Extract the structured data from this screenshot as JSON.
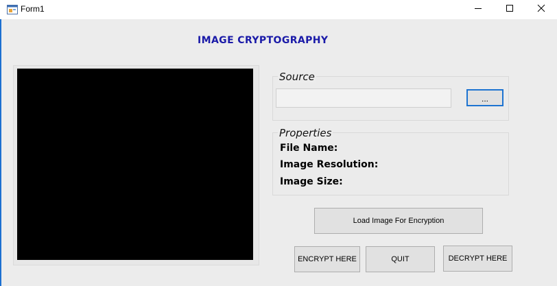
{
  "window": {
    "title": "Form1",
    "controls": {
      "minimize": "minimize-icon",
      "maximize": "maximize-icon",
      "close": "close-icon"
    }
  },
  "app": {
    "title": "IMAGE CRYPTOGRAPHY"
  },
  "source": {
    "group_title": "Source",
    "path_value": "",
    "browse_label": "..."
  },
  "properties": {
    "group_title": "Properties",
    "file_name_label": "File Name:",
    "resolution_label": "Image Resolution:",
    "size_label": "Image Size:"
  },
  "buttons": {
    "load": "Load Image For Encryption",
    "encrypt": "ENCRYPT HERE",
    "quit": "QUIT",
    "decrypt": "DECRYPT HERE"
  },
  "colors": {
    "title_text": "#1a1aa8",
    "focus_border": "#1d73d1",
    "picture_background": "#000000"
  }
}
